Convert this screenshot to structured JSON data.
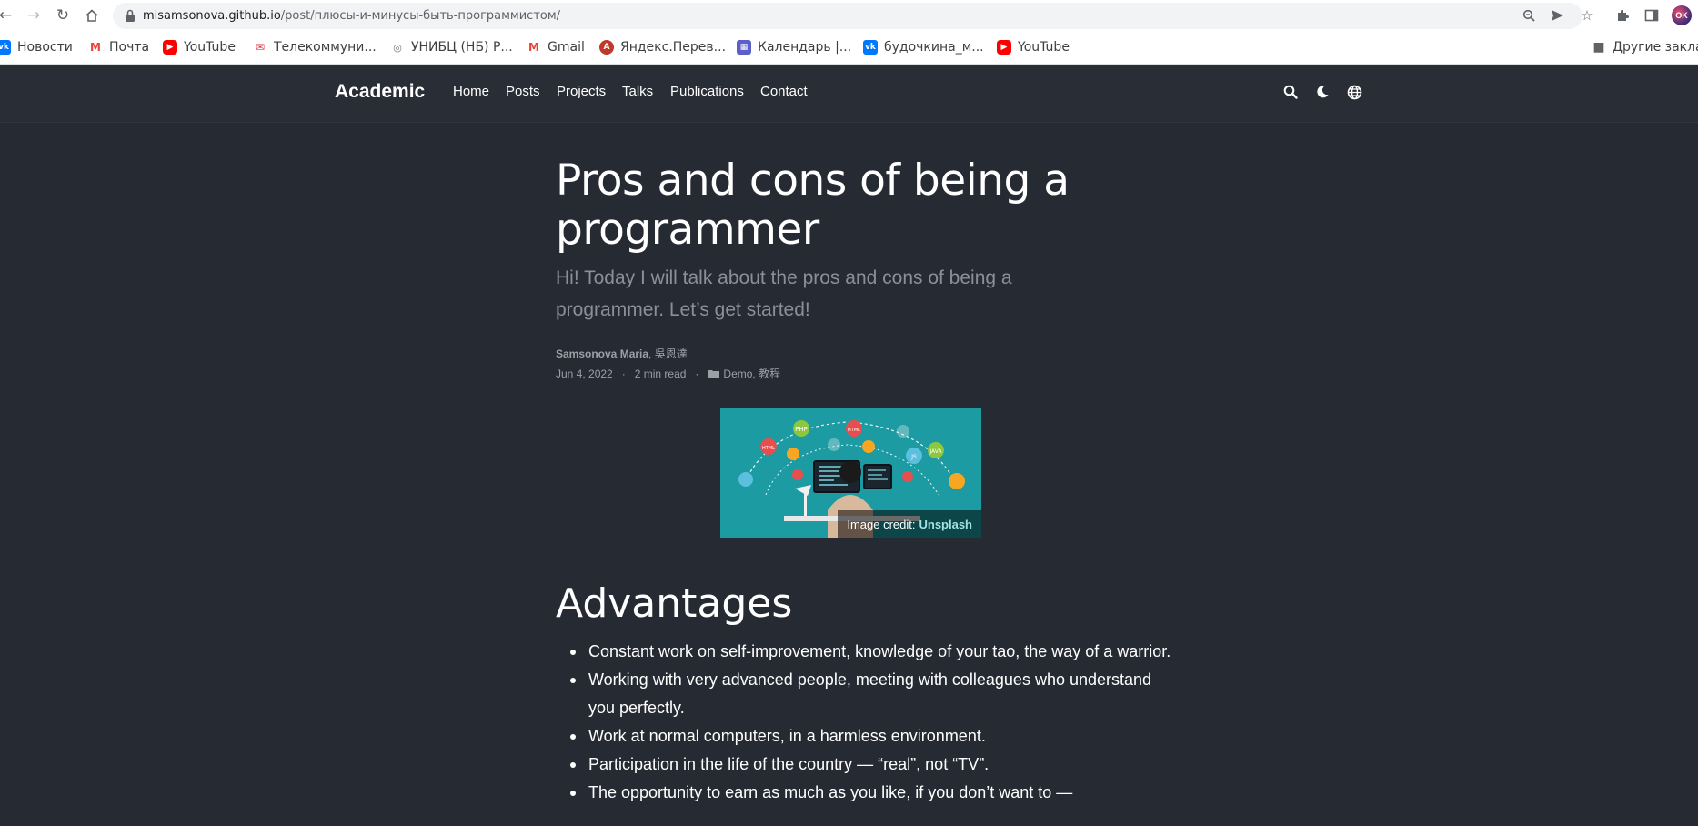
{
  "browser": {
    "url_host": "misamsonova.github.io",
    "url_path": "/post/плюсы-и-минусы-быть-программистом/",
    "bookmarks": [
      {
        "label": "Новости",
        "icon": "vk-icon"
      },
      {
        "label": "Почта",
        "icon": "gmail-icon"
      },
      {
        "label": "YouTube",
        "icon": "youtube-icon"
      },
      {
        "label": "Телекоммуни...",
        "icon": "telecom-icon"
      },
      {
        "label": "УНИБЦ (НБ) Р...",
        "icon": "unibc-icon"
      },
      {
        "label": "Gmail",
        "icon": "gmail-icon"
      },
      {
        "label": "Яндекс.Перев...",
        "icon": "yandex-translate-icon"
      },
      {
        "label": "Календарь |...",
        "icon": "calendar-icon"
      },
      {
        "label": "будочкина_м...",
        "icon": "vk-icon"
      },
      {
        "label": "YouTube",
        "icon": "youtube-icon"
      }
    ],
    "other_bookmarks": "Другие закла"
  },
  "site": {
    "brand": "Academic",
    "nav": [
      "Home",
      "Posts",
      "Projects",
      "Talks",
      "Publications",
      "Contact"
    ],
    "tools": [
      "search-icon",
      "moon-icon",
      "globe-icon"
    ]
  },
  "article": {
    "title": "Pros and cons of being a programmer",
    "subtitle": "Hi! Today I will talk about the pros and cons of being a programmer. Let’s get started!",
    "author": "Samsonova Maria",
    "coauthor": ", 吳恩達",
    "date": "Jun 4, 2022",
    "separator": "·",
    "read_time": "2 min read",
    "categories": "Demo, 教程",
    "image_credit_label": "Image credit:",
    "image_credit_link": "Unsplash",
    "section_heading": "Advantages",
    "advantages": [
      "Constant work on self-improvement, knowledge of your tao, the way of a warrior.",
      "Working with very advanced people, meeting with colleagues who understand you perfectly.",
      "Work at normal computers, in a harmless environment.",
      "Participation in the life of the country — “real”, not “TV”.",
      "The opportunity to earn as much as you like, if you don’t want to —"
    ]
  },
  "colors": {
    "page_bg": "#262a33",
    "navbar_bg": "#292d35",
    "subtitle": "#8a8f99",
    "meta": "#9aa0a6",
    "image_teal": "#1d9ba3",
    "credit_link": "#9de4e6"
  }
}
